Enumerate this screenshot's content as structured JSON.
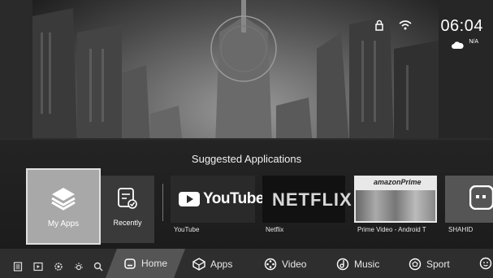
{
  "status": {
    "time": "06:04",
    "weather": "N/A",
    "icons": [
      "lock-icon",
      "wifi-icon",
      "cloud-icon"
    ]
  },
  "section_title": "Suggested Applications",
  "tiles": {
    "my_apps": "My Apps",
    "recently": "Recently"
  },
  "apps": [
    {
      "name": "YouTube",
      "logo": "YouTube"
    },
    {
      "name": "Netflix",
      "logo": "NETFLIX"
    },
    {
      "name": "Prime Video - Android T",
      "logo": "amazonPrime"
    },
    {
      "name": "SHAHID",
      "logo": ""
    }
  ],
  "bottom_icons": [
    "notes-icon",
    "play-icon",
    "settings-icon",
    "brightness-icon",
    "search-icon"
  ],
  "tabs": [
    {
      "label": "Home",
      "icon": "home-icon"
    },
    {
      "label": "Apps",
      "icon": "apps-icon"
    },
    {
      "label": "Video",
      "icon": "video-icon"
    },
    {
      "label": "Music",
      "icon": "music-icon"
    },
    {
      "label": "Sport",
      "icon": "sport-icon"
    }
  ],
  "colors": {
    "youtube_red": "#ffffff",
    "accent": "#555555"
  }
}
